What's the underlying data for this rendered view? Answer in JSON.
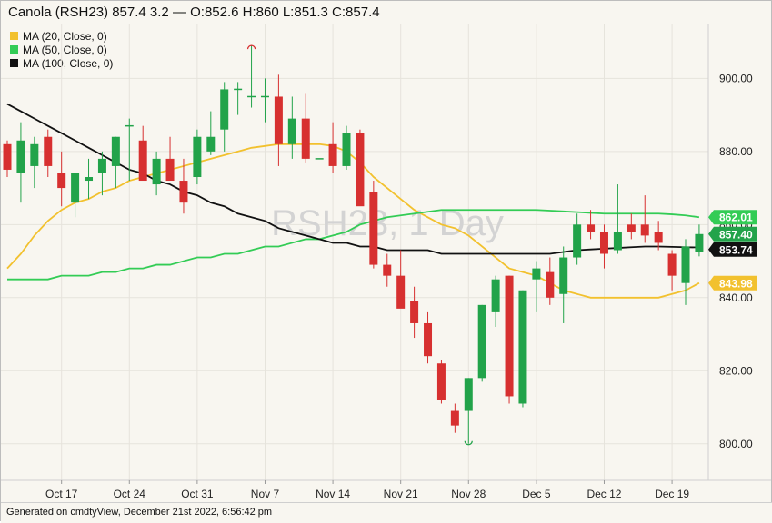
{
  "header": {
    "title": "Canola (RSH23) 857.4 3.2 — O:852.6 H:860 L:851.3 C:857.4"
  },
  "footer": {
    "text": "Generated on cmdtyView, December 21st 2022, 6:56:42 pm"
  },
  "colors": {
    "background": "#f8f6f0",
    "up": "#22a34a",
    "down": "#d73030",
    "ma20": "#f2c12e",
    "ma50": "#33cc55",
    "ma100": "#111111",
    "grid": "#e6e3dc",
    "watermark": "#d3d3d3"
  },
  "chart_data": {
    "type": "candlestick",
    "watermark": "RSH23, 1 Day",
    "ylim": [
      790,
      915
    ],
    "y_ticks": [
      {
        "value": 800,
        "label": "800.00"
      },
      {
        "value": 820,
        "label": "820.00"
      },
      {
        "value": 840,
        "label": "840.00"
      },
      {
        "value": 860,
        "label": "860.00"
      },
      {
        "value": 880,
        "label": "880.00"
      },
      {
        "value": 900,
        "label": "900.00"
      }
    ],
    "x_ticks": [
      "Oct 17",
      "Oct 24",
      "Oct 31",
      "Nov 7",
      "Nov 14",
      "Nov 21",
      "Nov 28",
      "Dec 5",
      "Dec 12",
      "Dec 19"
    ],
    "x_tick_index": [
      4,
      9,
      14,
      19,
      24,
      29,
      34,
      39,
      44,
      49
    ],
    "legend": [
      {
        "label": "MA (20, Close, 0)",
        "color": "#f2c12e"
      },
      {
        "label": "MA (50, Close, 0)",
        "color": "#33cc55"
      },
      {
        "label": "MA (100, Close, 0)",
        "color": "#111111"
      }
    ],
    "candles": [
      {
        "o": 882,
        "h": 883,
        "l": 873,
        "c": 875
      },
      {
        "o": 874,
        "h": 888,
        "l": 866,
        "c": 883
      },
      {
        "o": 876,
        "h": 884,
        "l": 870,
        "c": 882
      },
      {
        "o": 884,
        "h": 886,
        "l": 873,
        "c": 876
      },
      {
        "o": 874,
        "h": 880,
        "l": 865,
        "c": 870
      },
      {
        "o": 866,
        "h": 874,
        "l": 862,
        "c": 874
      },
      {
        "o": 872,
        "h": 878,
        "l": 867,
        "c": 873
      },
      {
        "o": 874,
        "h": 880,
        "l": 868,
        "c": 878
      },
      {
        "o": 876,
        "h": 884,
        "l": 870,
        "c": 884
      },
      {
        "o": 887,
        "h": 889,
        "l": 872,
        "c": 887
      },
      {
        "o": 883,
        "h": 887,
        "l": 873,
        "c": 872
      },
      {
        "o": 871,
        "h": 880,
        "l": 868,
        "c": 878
      },
      {
        "o": 878,
        "h": 884,
        "l": 873,
        "c": 872
      },
      {
        "o": 872,
        "h": 878,
        "l": 863,
        "c": 866
      },
      {
        "o": 873,
        "h": 886,
        "l": 871,
        "c": 884
      },
      {
        "o": 880,
        "h": 891,
        "l": 879,
        "c": 884
      },
      {
        "o": 886,
        "h": 899,
        "l": 880,
        "c": 897
      },
      {
        "o": 897,
        "h": 899,
        "l": 890,
        "c": 897
      },
      {
        "o": 895,
        "h": 909,
        "l": 892,
        "c": 895
      },
      {
        "o": 895,
        "h": 900,
        "l": 888,
        "c": 895
      },
      {
        "o": 895,
        "h": 901,
        "l": 876,
        "c": 882
      },
      {
        "o": 882,
        "h": 895,
        "l": 878,
        "c": 889
      },
      {
        "o": 889,
        "h": 896,
        "l": 877,
        "c": 878
      },
      {
        "o": 878,
        "h": 878,
        "l": 878,
        "c": 878
      },
      {
        "o": 882,
        "h": 888,
        "l": 874,
        "c": 876
      },
      {
        "o": 876,
        "h": 887,
        "l": 875,
        "c": 885
      },
      {
        "o": 885,
        "h": 886,
        "l": 868,
        "c": 865
      },
      {
        "o": 869,
        "h": 872,
        "l": 848,
        "c": 849
      },
      {
        "o": 849,
        "h": 852,
        "l": 843,
        "c": 846
      },
      {
        "o": 846,
        "h": 853,
        "l": 838,
        "c": 837
      },
      {
        "o": 839,
        "h": 843,
        "l": 829,
        "c": 833
      },
      {
        "o": 833,
        "h": 836,
        "l": 822,
        "c": 824
      },
      {
        "o": 822,
        "h": 823,
        "l": 811,
        "c": 812
      },
      {
        "o": 809,
        "h": 811,
        "l": 803,
        "c": 805
      },
      {
        "o": 809,
        "h": 818,
        "l": 800,
        "c": 818
      },
      {
        "o": 818,
        "h": 838,
        "l": 817,
        "c": 838
      },
      {
        "o": 836,
        "h": 846,
        "l": 832,
        "c": 845
      },
      {
        "o": 846,
        "h": 846,
        "l": 811,
        "c": 813
      },
      {
        "o": 811,
        "h": 842,
        "l": 810,
        "c": 842
      },
      {
        "o": 845,
        "h": 850,
        "l": 836,
        "c": 848
      },
      {
        "o": 847,
        "h": 851,
        "l": 838,
        "c": 840
      },
      {
        "o": 841,
        "h": 854,
        "l": 833,
        "c": 851
      },
      {
        "o": 851,
        "h": 863,
        "l": 849,
        "c": 860
      },
      {
        "o": 860,
        "h": 864,
        "l": 856,
        "c": 858
      },
      {
        "o": 858,
        "h": 860,
        "l": 848,
        "c": 852
      },
      {
        "o": 853,
        "h": 871,
        "l": 852,
        "c": 858
      },
      {
        "o": 860,
        "h": 863,
        "l": 856,
        "c": 858
      },
      {
        "o": 860,
        "h": 868,
        "l": 855,
        "c": 857
      },
      {
        "o": 858,
        "h": 861,
        "l": 853,
        "c": 855
      },
      {
        "o": 852,
        "h": 853,
        "l": 842,
        "c": 846
      },
      {
        "o": 844,
        "h": 856,
        "l": 838,
        "c": 854
      },
      {
        "o": 852.6,
        "h": 860,
        "l": 851.3,
        "c": 857.4
      }
    ],
    "open_markers": [
      {
        "index": 18,
        "value": 909
      },
      {
        "index": 34,
        "value": 800
      }
    ],
    "series": [
      {
        "name": "MA (20, Close, 0)",
        "color": "#f2c12e",
        "last_label": "843.98",
        "values": [
          848,
          852,
          857,
          861,
          864,
          866,
          867,
          869,
          870,
          872,
          873,
          874,
          875,
          876,
          877,
          878,
          879,
          880,
          881,
          881.5,
          882,
          882,
          882,
          882,
          881.5,
          880,
          877,
          873,
          870,
          867,
          864,
          862,
          860,
          859,
          857,
          854,
          851,
          848,
          847,
          846,
          844,
          842,
          841,
          840,
          840,
          840,
          840,
          840,
          840,
          841,
          842,
          844
        ]
      },
      {
        "name": "MA (50, Close, 0)",
        "color": "#33cc55",
        "last_label": "862.01",
        "values": [
          845,
          845,
          845,
          845,
          846,
          846,
          846,
          847,
          847,
          848,
          848,
          849,
          849,
          850,
          851,
          851,
          852,
          852,
          853,
          854,
          854,
          855,
          856,
          856,
          857,
          858,
          860,
          861,
          862,
          862.5,
          863,
          863.5,
          864,
          864,
          864,
          864,
          864,
          864,
          864,
          864,
          863.8,
          863.6,
          863.4,
          863.2,
          863,
          863,
          863,
          863,
          863,
          862.8,
          862.5,
          862
        ]
      },
      {
        "name": "MA (100, Close, 0)",
        "color": "#111111",
        "last_label": "853.74",
        "values": [
          893,
          891,
          889,
          887,
          885,
          883,
          881,
          879,
          877,
          875,
          874,
          872,
          871,
          869,
          868,
          866,
          865,
          863,
          862,
          861,
          859,
          858,
          857,
          856,
          855,
          855,
          854,
          854,
          853,
          853,
          853,
          853,
          852,
          852,
          852,
          852,
          852,
          852,
          852,
          852,
          852,
          852.5,
          853,
          853.2,
          853.4,
          853.6,
          853.8,
          854,
          854,
          853.9,
          853.8,
          853.74
        ]
      }
    ],
    "price_labels": [
      {
        "label": "862.01",
        "value": 862.01,
        "bg": "#33cc55",
        "fg": "#ffffff"
      },
      {
        "label": "857.40",
        "value": 857.4,
        "bg": "#22a34a",
        "fg": "#ffffff"
      },
      {
        "label": "853.74",
        "value": 853.74,
        "bg": "#111111",
        "fg": "#ffffff"
      },
      {
        "label": "843.98",
        "value": 843.98,
        "bg": "#f2c12e",
        "fg": "#ffffff"
      }
    ]
  }
}
